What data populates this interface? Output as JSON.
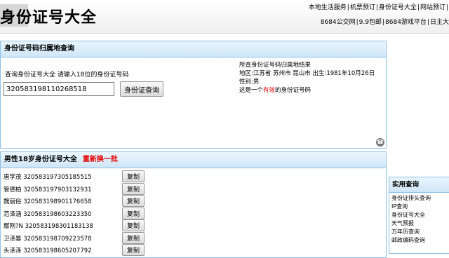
{
  "header": {
    "site_title": "身份证号大全",
    "links_row1": [
      "本地生活服务",
      "机票预订",
      "身份证号大全",
      "网站预订"
    ],
    "links_row2": [
      "8684公交网",
      "9.9包邮",
      "8684游戏平台",
      "日主大"
    ]
  },
  "query_panel": {
    "title": "身份证号码归属地查询",
    "label": "查询身份证号大全 请输入18位的身份证号码",
    "input_value": "320583198110268518",
    "button_label": "身份证查询",
    "result_lines": [
      "所查身份证号码归属地结果",
      "地区:江苏省 苏州市 昆山市 出生:1981年10月26日",
      "性别:男"
    ],
    "valid_text_prefix": "这是一个",
    "valid_text_highlight": "有效",
    "valid_text_suffix": "的身份证号码"
  },
  "list_panel": {
    "title": "男性18岁身份证号大全",
    "refresh_label": "重新换一批",
    "copy_label": "复制",
    "rows": [
      {
        "name": "唐学茂",
        "id": "320583197305185515"
      },
      {
        "name": "管德柏",
        "id": "320583197903132931"
      },
      {
        "name": "魏丽俗",
        "id": "320583198901176658"
      },
      {
        "name": "范泽涵",
        "id": "320583198603223350"
      },
      {
        "name": "鄢刚?N",
        "id": "320583198301183138"
      },
      {
        "name": "卫泽晏",
        "id": "320583198709223578"
      },
      {
        "name": "头泽泽",
        "id": "320583198605207792"
      }
    ]
  },
  "sidebar": {
    "title": "实用查询",
    "items": [
      "身份证排头查询",
      "IP查询",
      "身份证号大全",
      "天气预报",
      "万年历查询",
      "邮政编码查询"
    ]
  }
}
